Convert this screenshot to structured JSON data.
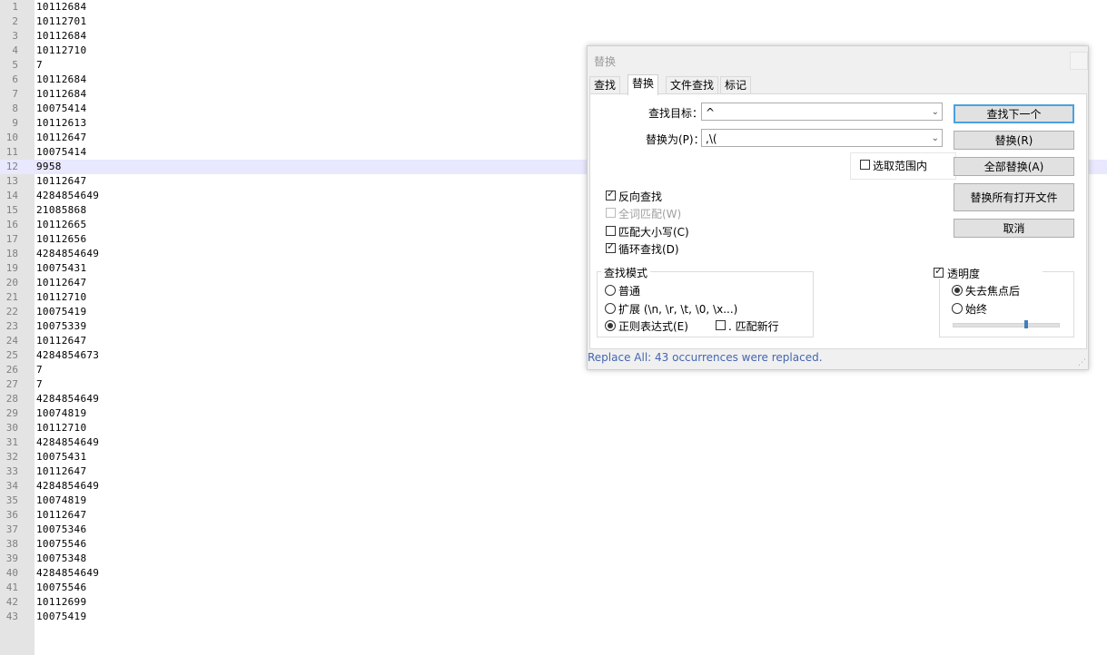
{
  "editor": {
    "current_line": 12,
    "lines": [
      {
        "num": "1",
        "text": "10112684"
      },
      {
        "num": "2",
        "text": "10112701"
      },
      {
        "num": "3",
        "text": "10112684"
      },
      {
        "num": "4",
        "text": "10112710"
      },
      {
        "num": "5",
        "text": "7"
      },
      {
        "num": "6",
        "text": "10112684"
      },
      {
        "num": "7",
        "text": "10112684"
      },
      {
        "num": "8",
        "text": "10075414"
      },
      {
        "num": "9",
        "text": "10112613"
      },
      {
        "num": "10",
        "text": "10112647"
      },
      {
        "num": "11",
        "text": "10075414"
      },
      {
        "num": "12",
        "text": "9958"
      },
      {
        "num": "13",
        "text": "10112647"
      },
      {
        "num": "14",
        "text": "4284854649"
      },
      {
        "num": "15",
        "text": "21085868"
      },
      {
        "num": "16",
        "text": "10112665"
      },
      {
        "num": "17",
        "text": "10112656"
      },
      {
        "num": "18",
        "text": "4284854649"
      },
      {
        "num": "19",
        "text": "10075431"
      },
      {
        "num": "20",
        "text": "10112647"
      },
      {
        "num": "21",
        "text": "10112710"
      },
      {
        "num": "22",
        "text": "10075419"
      },
      {
        "num": "23",
        "text": "10075339"
      },
      {
        "num": "24",
        "text": "10112647"
      },
      {
        "num": "25",
        "text": "4284854673"
      },
      {
        "num": "26",
        "text": "7"
      },
      {
        "num": "27",
        "text": "7"
      },
      {
        "num": "28",
        "text": "4284854649"
      },
      {
        "num": "29",
        "text": "10074819"
      },
      {
        "num": "30",
        "text": "10112710"
      },
      {
        "num": "31",
        "text": "4284854649"
      },
      {
        "num": "32",
        "text": "10075431"
      },
      {
        "num": "33",
        "text": "10112647"
      },
      {
        "num": "34",
        "text": "4284854649"
      },
      {
        "num": "35",
        "text": "10074819"
      },
      {
        "num": "36",
        "text": "10112647"
      },
      {
        "num": "37",
        "text": "10075346"
      },
      {
        "num": "38",
        "text": "10075546"
      },
      {
        "num": "39",
        "text": "10075348"
      },
      {
        "num": "40",
        "text": "4284854649"
      },
      {
        "num": "41",
        "text": "10075546"
      },
      {
        "num": "42",
        "text": "10112699"
      },
      {
        "num": "43",
        "text": "10075419"
      }
    ]
  },
  "dialog": {
    "title": "替换",
    "tabs": [
      "查找",
      "替换",
      "文件查找",
      "标记"
    ],
    "active_tab": "替换",
    "find_label": "查找目标：",
    "find_value": "^",
    "replace_label": "替换为(P)：",
    "replace_value": ",\\(",
    "in_selection_label": "选取范围内",
    "buttons": {
      "find_next": "查找下一个",
      "replace": "替换(R)",
      "replace_all": "全部替换(A)",
      "replace_all_open": "替换所有打开文件",
      "cancel": "取消"
    },
    "options": {
      "backward": {
        "label": "反向查找",
        "checked": true
      },
      "whole_word": {
        "label": "全词匹配(W)",
        "checked": false,
        "enabled": false
      },
      "match_case": {
        "label": "匹配大小写(C)",
        "checked": false
      },
      "wrap": {
        "label": "循环查找(D)",
        "checked": true
      }
    },
    "search_mode": {
      "title": "查找模式",
      "normal": "普通",
      "extended": "扩展 (\\n, \\r, \\t, \\0, \\x...)",
      "regex": "正则表达式(E)",
      "selected": "regex",
      "dot_newline": ". 匹配新行"
    },
    "transparency": {
      "title": "透明度",
      "checked": true,
      "on_lose_focus": "失去焦点后",
      "always": "始终",
      "selected": "on_lose_focus",
      "level": 0.7
    },
    "status": "Replace All: 43 occurrences were replaced."
  }
}
